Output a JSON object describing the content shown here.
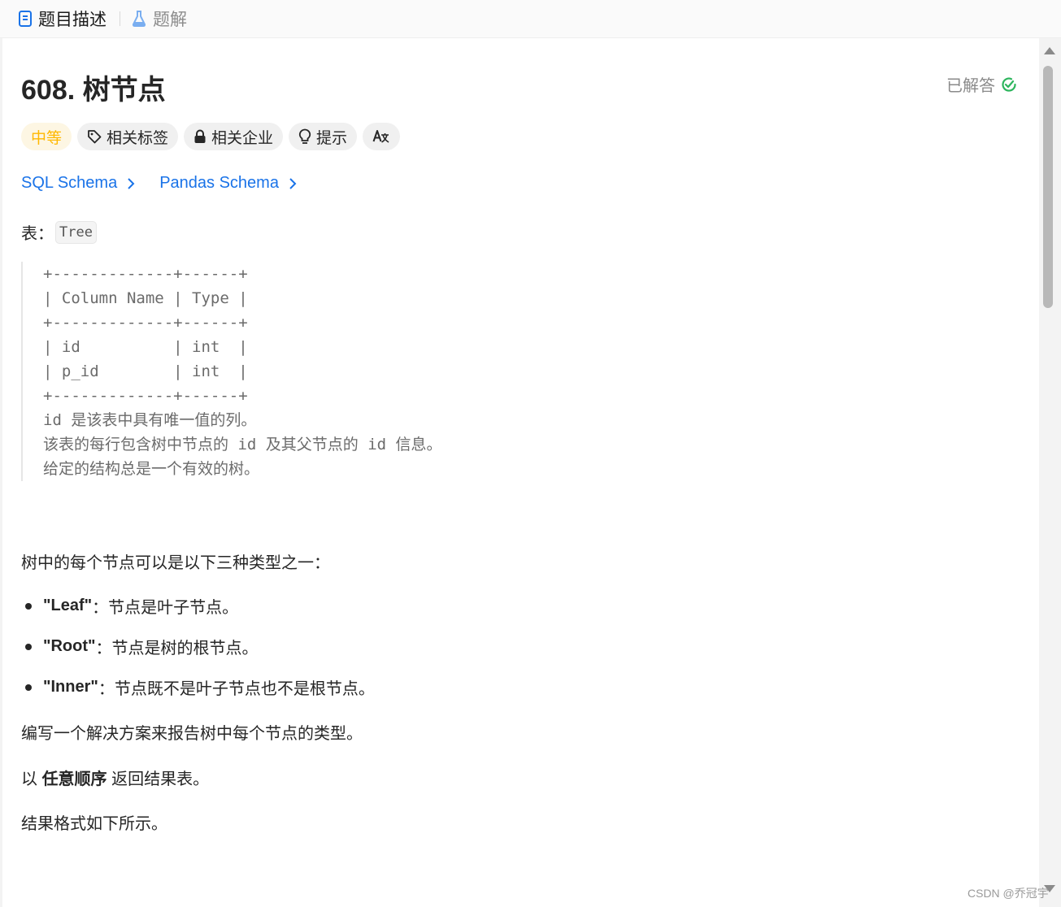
{
  "tabs": [
    {
      "label": "题目描述",
      "icon": "document-icon"
    },
    {
      "label": "题解",
      "icon": "flask-icon"
    }
  ],
  "problem": {
    "title": "608. 树节点",
    "status": "已解答",
    "status_color": "#2db55d"
  },
  "tags": [
    {
      "label": "中等",
      "icon": ""
    },
    {
      "label": "相关标签",
      "icon": "tag-icon"
    },
    {
      "label": "相关企业",
      "icon": "lock-icon"
    },
    {
      "label": "提示",
      "icon": "lightbulb-icon"
    },
    {
      "label": "",
      "icon": "translate-icon"
    }
  ],
  "schema_links": [
    "SQL Schema",
    "Pandas Schema"
  ],
  "table_intro": {
    "prefix": "表：",
    "name": "Tree"
  },
  "schema_block": [
    "+-------------+------+",
    "| Column Name | Type |",
    "+-------------+------+",
    "| id          | int  |",
    "| p_id        | int  |",
    "+-------------+------+",
    "id 是该表中具有唯一值的列。",
    "该表的每行包含树中节点的 id 及其父节点的 id 信息。",
    "给定的结构总是一个有效的树。"
  ],
  "body": {
    "intro": "树中的每个节点可以是以下三种类型之一：",
    "bullets": [
      {
        "term": "\"Leaf\"",
        "desc": "：节点是叶子节点。"
      },
      {
        "term": "\"Root\"",
        "desc": "：节点是树的根节点。"
      },
      {
        "term": "\"Inner\"",
        "desc": "：节点既不是叶子节点也不是根节点。"
      }
    ],
    "task": "编写一个解决方案来报告树中每个节点的类型。",
    "order_prefix": "以 ",
    "order_bold": "任意顺序",
    "order_suffix": " 返回结果表。",
    "format": "结果格式如下所示。"
  },
  "watermark": "CSDN @乔冠宇",
  "colors": {
    "accent_link": "#1a73e8",
    "difficulty_medium": "#ffb800"
  }
}
